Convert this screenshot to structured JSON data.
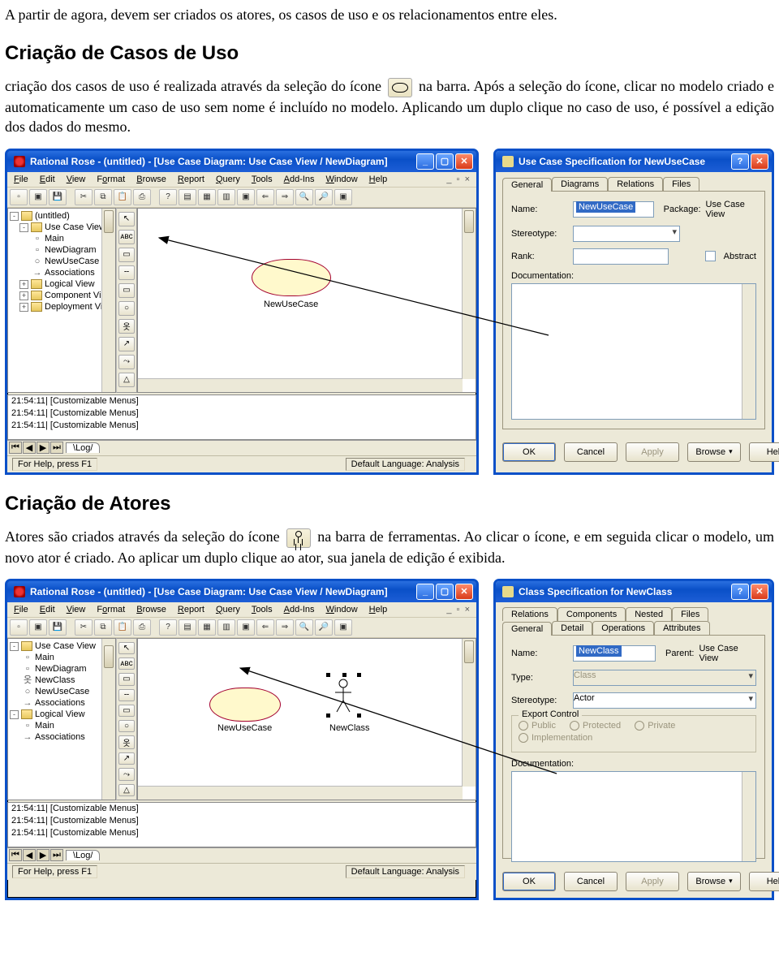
{
  "para1": "A partir de agora, devem ser criados os atores, os casos de uso e os relacionamentos entre eles.",
  "h_uc": "Criação de Casos de Uso",
  "para_uc_a": "criação dos casos de uso é realizada através da seleção do ícone",
  "para_uc_b": " na barra. Após a seleção do ícone, clicar no modelo criado e automaticamente um caso de uso sem nome é incluído no modelo. Aplicando um duplo clique no caso de uso, é possível a edição dos dados do mesmo.",
  "h_actor": "Criação de Atores",
  "para_actor_a": "Atores são criados através da seleção do ícone",
  "para_actor_b": " na barra de ferramentas. Ao clicar o ícone, e em seguida clicar o modelo, um novo ator é criado. Ao aplicar um duplo clique ao ator, sua janela de edição é exibida.",
  "rose1": {
    "title": "Rational Rose - (untitled) - [Use Case Diagram: Use Case View / NewDiagram]",
    "menu": [
      "File",
      "Edit",
      "View",
      "Format",
      "Browse",
      "Report",
      "Query",
      "Tools",
      "Add-Ins",
      "Window",
      "Help"
    ],
    "tree": [
      "(untitled)",
      "Use Case View",
      "Main",
      "NewDiagram",
      "NewUseCase",
      "Associations",
      "Logical View",
      "Component View",
      "Deployment View"
    ],
    "usecase_label": "NewUseCase",
    "log": [
      "21:54:11|  [Customizable Menus]",
      "21:54:11|  [Customizable Menus]",
      "21:54:11|  [Customizable Menus]"
    ],
    "logtab": "Log",
    "status_left": "For Help, press F1",
    "status_right": "Default Language: Analysis"
  },
  "spec1": {
    "title": "Use Case Specification for NewUseCase",
    "tabs": [
      "General",
      "Diagrams",
      "Relations",
      "Files"
    ],
    "name_label": "Name:",
    "name_value": "NewUseCase",
    "pkg_label": "Package:",
    "pkg_value": "Use Case View",
    "stereo_label": "Stereotype:",
    "rank_label": "Rank:",
    "abstract_label": "Abstract",
    "doc_label": "Documentation:",
    "btn_ok": "OK",
    "btn_cancel": "Cancel",
    "btn_apply": "Apply",
    "btn_browse": "Browse",
    "btn_help": "Help"
  },
  "rose2": {
    "title": "Rational Rose - (untitled) - [Use Case Diagram: Use Case View / NewDiagram]",
    "menu": [
      "File",
      "Edit",
      "View",
      "Format",
      "Browse",
      "Report",
      "Query",
      "Tools",
      "Add-Ins",
      "Window",
      "Help"
    ],
    "tree": [
      "Use Case View",
      "Main",
      "NewDiagram",
      "NewClass",
      "NewUseCase",
      "Associations",
      "Logical View",
      "Main",
      "Associations"
    ],
    "usecase_label": "NewUseCase",
    "actor_label": "NewClass",
    "log": [
      "21:54:11|  [Customizable Menus]",
      "21:54:11|  [Customizable Menus]",
      "21:54:11|  [Customizable Menus]"
    ],
    "logtab": "Log",
    "status_left": "For Help, press F1",
    "status_right": "Default Language: Analysis"
  },
  "spec2": {
    "title": "Class Specification for NewClass",
    "tabs_row1": [
      "Relations",
      "Components",
      "Nested",
      "Files"
    ],
    "tabs_row2": [
      "General",
      "Detail",
      "Operations",
      "Attributes"
    ],
    "name_label": "Name:",
    "name_value": "NewClass",
    "parent_label": "Parent:",
    "parent_value": "Use Case View",
    "type_label": "Type:",
    "type_value": "Class",
    "stereo_label": "Stereotype:",
    "stereo_value": "Actor",
    "export_legend": "Export Control",
    "radios": [
      "Public",
      "Protected",
      "Private",
      "Implementation"
    ],
    "doc_label": "Documentation:",
    "btn_ok": "OK",
    "btn_cancel": "Cancel",
    "btn_apply": "Apply",
    "btn_browse": "Browse",
    "btn_help": "Help"
  }
}
